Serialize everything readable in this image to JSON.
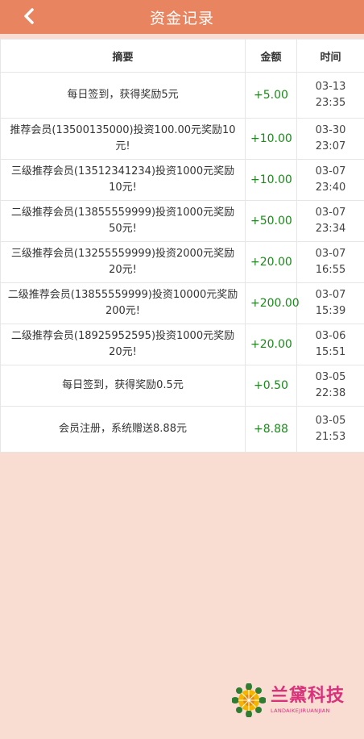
{
  "header": {
    "title": "资金记录"
  },
  "table": {
    "col_summary": "摘要",
    "col_amount": "金额",
    "col_time": "时间",
    "rows": [
      {
        "summary": "每日签到，获得奖励5元",
        "amount": "+5.00",
        "date": "03-13",
        "clock": "23:35"
      },
      {
        "summary": "推荐会员(13500135000)投资100.00元奖励10元!",
        "amount": "+10.00",
        "date": "03-30",
        "clock": "23:07"
      },
      {
        "summary": "三级推荐会员(13512341234)投资1000元奖励10元!",
        "amount": "+10.00",
        "date": "03-07",
        "clock": "23:40"
      },
      {
        "summary": "二级推荐会员(13855559999)投资1000元奖励50元!",
        "amount": "+50.00",
        "date": "03-07",
        "clock": "23:34"
      },
      {
        "summary": "三级推荐会员(13255559999)投资2000元奖励20元!",
        "amount": "+20.00",
        "date": "03-07",
        "clock": "16:55"
      },
      {
        "summary": "二级推荐会员(13855559999)投资10000元奖励200元!",
        "amount": "+200.00",
        "date": "03-07",
        "clock": "15:39"
      },
      {
        "summary": "二级推荐会员(18925952595)投资1000元奖励20元!",
        "amount": "+20.00",
        "date": "03-06",
        "clock": "15:51"
      },
      {
        "summary": "每日签到，获得奖励0.5元",
        "amount": "+0.50",
        "date": "03-05",
        "clock": "22:38"
      },
      {
        "summary": "会员注册，系统赠送8.88元",
        "amount": "+8.88",
        "date": "03-05",
        "clock": "21:53"
      }
    ]
  },
  "logo": {
    "cn": "兰黛科技",
    "en": "LANDAIKEJIRUANJIAN"
  },
  "colors": {
    "header": "#e8845f",
    "background": "#f9dcd2",
    "amount": "#1a8a1a",
    "logo": "#d8327a"
  }
}
